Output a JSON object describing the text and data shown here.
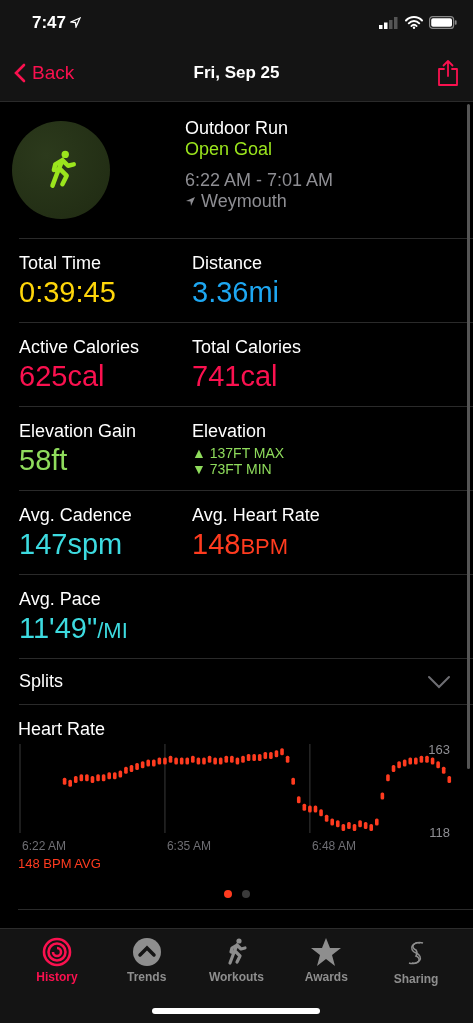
{
  "status_bar": {
    "time": "7:47"
  },
  "nav": {
    "back": "Back",
    "title": "Fri, Sep 25"
  },
  "workout": {
    "name": "Outdoor Run",
    "goal": "Open Goal",
    "time_range": "6:22 AM - 7:01 AM",
    "location": "Weymouth"
  },
  "metrics": [
    [
      {
        "kind": "value",
        "label": "Total Time",
        "value": "0:39:45",
        "color": "#ffd60a"
      },
      {
        "kind": "value",
        "label": "Distance",
        "value": "3.36mi",
        "color": "#1ea7f2"
      }
    ],
    [
      {
        "kind": "value",
        "label": "Active Calories",
        "value": "625cal",
        "color": "#fa114f"
      },
      {
        "kind": "value",
        "label": "Total Calories",
        "value": "741cal",
        "color": "#fa114f"
      }
    ],
    [
      {
        "kind": "value",
        "label": "Elevation Gain",
        "value": "58ft",
        "color": "#8fdc5c"
      },
      {
        "kind": "range",
        "label": "Elevation",
        "lines": [
          "▲ 137FT MAX",
          "▼ 73FT MIN"
        ],
        "color": "#8fdc5c"
      }
    ],
    [
      {
        "kind": "value",
        "label": "Avg. Cadence",
        "value": "147spm",
        "color": "#3ddbe0"
      },
      {
        "kind": "value",
        "label": "Avg. Heart Rate",
        "value": "148",
        "unit": "BPM",
        "color": "#ff3b1f"
      }
    ],
    [
      {
        "kind": "value",
        "label": "Avg. Pace",
        "value": "11'49\"",
        "unit": "/MI",
        "color": "#3ddbe0"
      }
    ]
  ],
  "splits": {
    "label": "Splits",
    "expanded": false
  },
  "heart_rate": {
    "title": "Heart Rate",
    "average": "148 BPM AVG",
    "time_labels": [
      "6:22 AM",
      "6:35 AM",
      "6:48 AM"
    ],
    "max_label": "163",
    "min_label": "118"
  },
  "pages": [
    {
      "selected": true
    },
    {
      "selected": false
    }
  ],
  "tabs": [
    {
      "label": "History",
      "selected": true
    },
    {
      "label": "Trends",
      "selected": false
    },
    {
      "label": "Workouts",
      "selected": false
    },
    {
      "label": "Awards",
      "selected": false
    },
    {
      "label": "Sharing",
      "selected": false
    }
  ]
}
